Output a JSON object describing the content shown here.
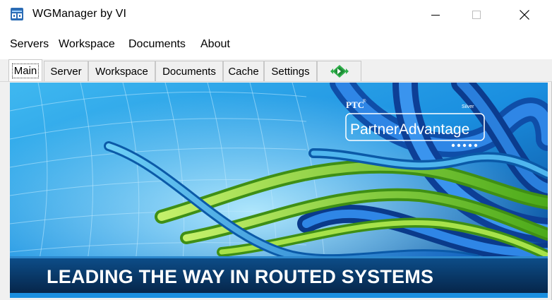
{
  "window": {
    "title": "WGManager by VI",
    "controls": {
      "minimize": "minimize",
      "maximize": "maximize",
      "close": "close"
    }
  },
  "menu": {
    "items": [
      "Servers",
      "Workspace",
      "Documents",
      "About"
    ]
  },
  "tabs": {
    "items": [
      "Main",
      "Server",
      "Workspace",
      "Documents",
      "Cache",
      "Settings"
    ],
    "active": "Main",
    "extra_icon": "green-diamond-arrows-icon"
  },
  "banner": {
    "ptc_label": "PTC",
    "tier_label": "Silver",
    "partner_logo_text": "PartnerAdvantage",
    "tagline": "LEADING THE WAY IN ROUTED SYSTEMS"
  },
  "colors": {
    "title_bar": "#ffffff",
    "menu_bar": "#ffffff",
    "tab_background": "#f0f0f0",
    "banner_blue": "#1a8fe0",
    "banner_dark": "#0a2a52",
    "cable_green": "#7ed321",
    "accent_icon_green": "#2fae4a"
  }
}
